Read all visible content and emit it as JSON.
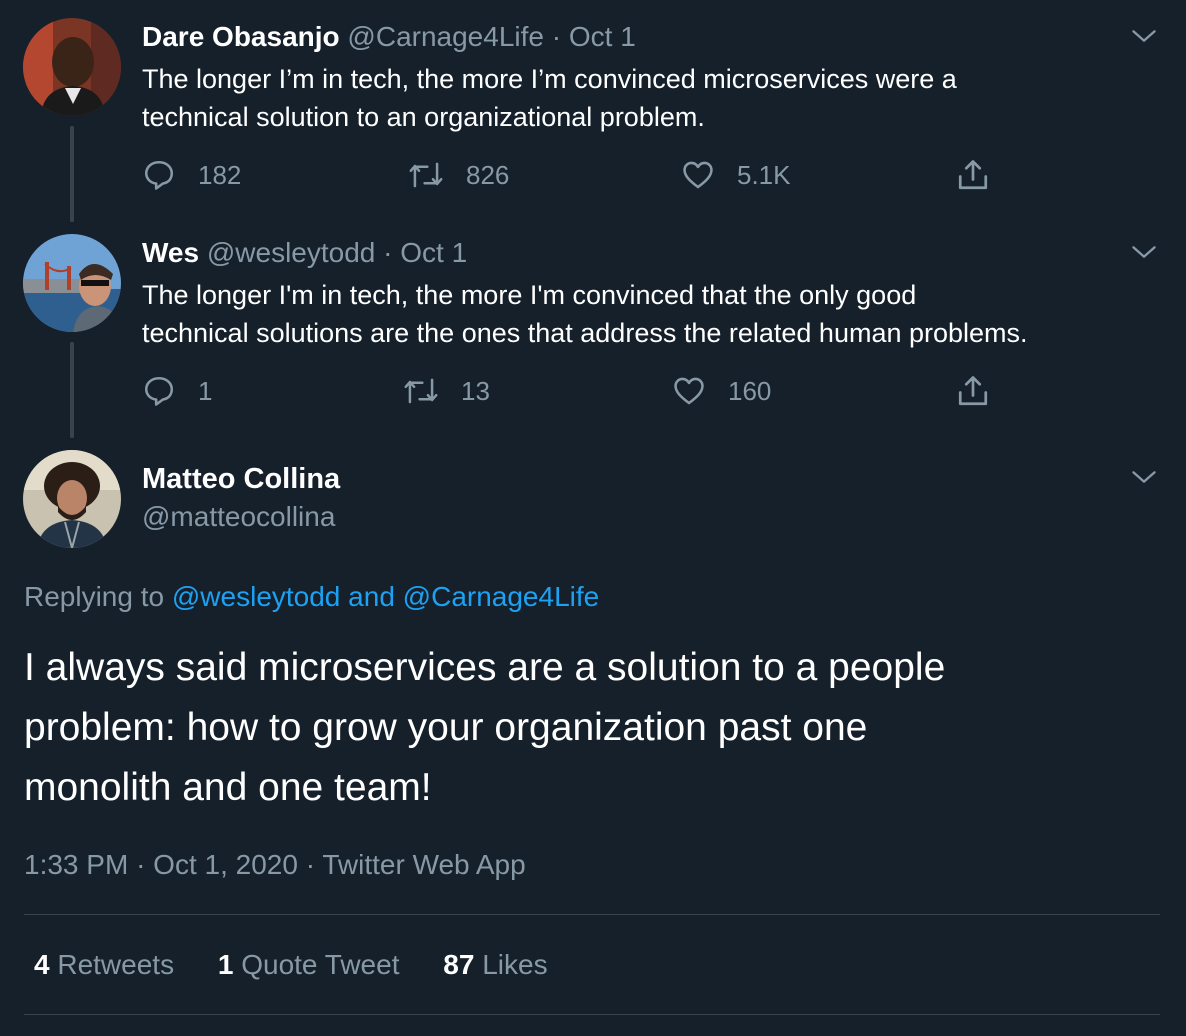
{
  "thread": [
    {
      "name": "Dare Obasanjo",
      "handle": "@Carnage4Life",
      "sep": "·",
      "date": "Oct 1",
      "text_line1": "The longer I’m in tech, the more I’m convinced microservices were a",
      "text_line2": "technical solution to an organizational problem.",
      "replies": "182",
      "retweets": "826",
      "likes": "5.1K"
    },
    {
      "name": "Wes",
      "handle": "@wesleytodd",
      "sep": "·",
      "date": "Oct 1",
      "text_line1": "The longer I'm in tech, the more I'm convinced that the only good",
      "text_line2": "technical solutions are the ones that address the related human problems.",
      "replies": "1",
      "retweets": "13",
      "likes": "160"
    }
  ],
  "main": {
    "name": "Matteo Collina",
    "handle": "@matteocollina",
    "replying_prefix": "Replying to",
    "replying_user1": "@wesleytodd",
    "replying_and": "and",
    "replying_user2": "@Carnage4Life",
    "text_line1": "I always said microservices are a solution to a people",
    "text_line2": "problem: how to grow your organization past one",
    "text_line3": "monolith and one team!",
    "time": "1:33 PM",
    "sep": "·",
    "date": "Oct 1, 2020",
    "source": "Twitter Web App",
    "stats": {
      "retweets_count": "4",
      "retweets_label": "Retweets",
      "quotes_count": "1",
      "quotes_label": "Quote Tweet",
      "likes_count": "87",
      "likes_label": "Likes"
    }
  },
  "icons": {
    "reply": "reply-icon",
    "retweet": "retweet-icon",
    "like": "heart-icon",
    "share": "share-icon",
    "more": "chevron-down-icon"
  },
  "colors": {
    "background": "#15202b",
    "text": "#ffffff",
    "muted": "#8899a6",
    "link": "#1da1f2",
    "border": "#38444d"
  }
}
